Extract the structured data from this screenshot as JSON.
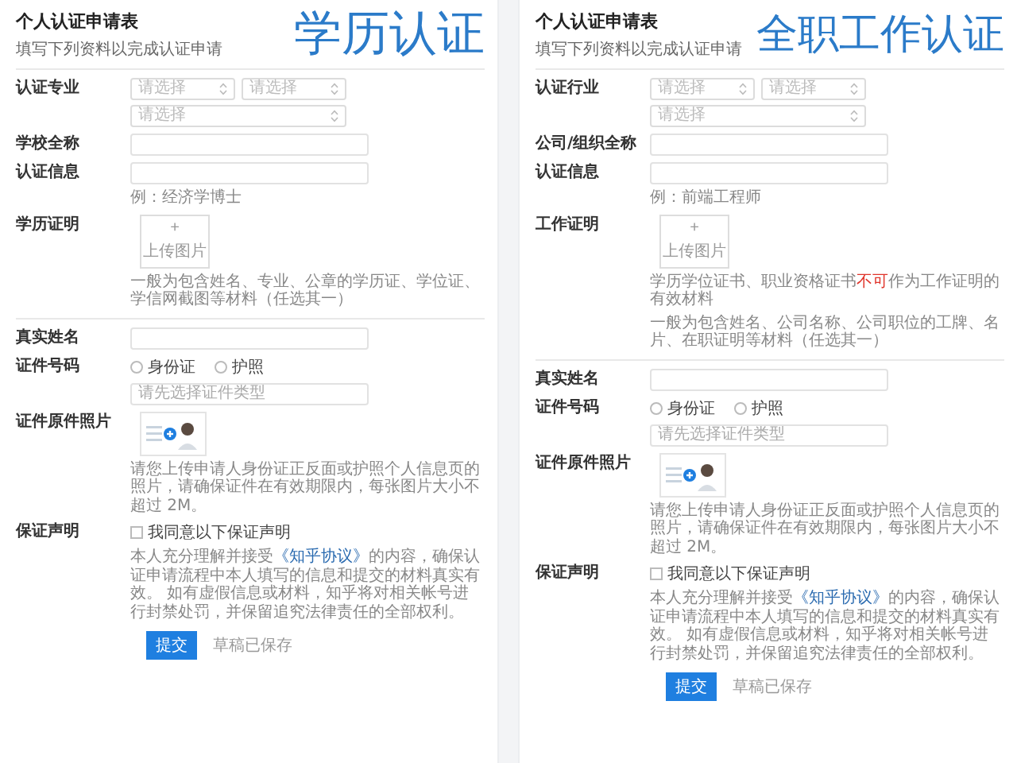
{
  "panels": [
    {
      "title": "个人认证申请表",
      "subtitle": "填写下列资料以完成认证申请",
      "banner": "学历认证",
      "sections": [
        {
          "rows": [
            {
              "kind": "selects",
              "label": "认证专业",
              "select_rows": [
                [
                  {
                    "placeholder": "请选择"
                  },
                  {
                    "placeholder": "请选择"
                  }
                ],
                [
                  {
                    "placeholder": "请选择"
                  }
                ]
              ]
            },
            {
              "kind": "input",
              "label": "学校全称"
            },
            {
              "kind": "input",
              "label": "认证信息",
              "hint": [
                [
                  {
                    "text": "例：经济学博士",
                    "kind": "text"
                  }
                ]
              ]
            },
            {
              "kind": "upload",
              "label": "学历证明",
              "upload": {
                "sign": "+",
                "text": "上传图片"
              },
              "hint": [
                [
                  {
                    "text": "一般为包含姓名、专业、公章的学历证、学位证、学信网截图等材料（任选其一）",
                    "kind": "text"
                  }
                ]
              ]
            }
          ]
        },
        {
          "rows": [
            {
              "kind": "input",
              "label": "真实姓名"
            },
            {
              "kind": "radios",
              "label": "证件号码",
              "options": [
                {
                  "label": "身份证",
                  "selected": false
                },
                {
                  "label": "护照",
                  "selected": false
                }
              ],
              "input": {
                "placeholder": "请先选择证件类型"
              }
            },
            {
              "kind": "id_photo",
              "label": "证件原件照片",
              "hint": [
                [
                  {
                    "text": "请您上传申请人身份证正反面或护照个人信息页的照片，请确保证件在有效期限内，每张图片大小不超过 2M。",
                    "kind": "text"
                  }
                ]
              ]
            },
            {
              "kind": "agreement",
              "label": "保证声明",
              "checkbox": {
                "label": "我同意以下保证声明",
                "checked": false
              },
              "hint": [
                [
                  {
                    "text": "本人充分理解并接受",
                    "kind": "text"
                  },
                  {
                    "text": "《知乎协议》",
                    "kind": "link"
                  },
                  {
                    "text": "的内容，确保认证申请流程中本人填写的信息和提交的材料真实有效。 如有虚假信息或材料，知乎将对相关帐号进行封禁处罚，并保留追究法律责任的全部权利。",
                    "kind": "text"
                  }
                ]
              ]
            }
          ]
        }
      ],
      "actions": {
        "submit": "提交",
        "draft": "草稿已保存"
      }
    },
    {
      "title": "个人认证申请表",
      "subtitle": "填写下列资料以完成认证申请",
      "banner": "全职工作认证",
      "sections": [
        {
          "rows": [
            {
              "kind": "selects",
              "label": "认证行业",
              "select_rows": [
                [
                  {
                    "placeholder": "请选择"
                  },
                  {
                    "placeholder": "请选择"
                  }
                ],
                [
                  {
                    "placeholder": "请选择"
                  }
                ]
              ]
            },
            {
              "kind": "input",
              "label": "公司/组织全称"
            },
            {
              "kind": "input",
              "label": "认证信息",
              "hint": [
                [
                  {
                    "text": "例：前端工程师",
                    "kind": "text"
                  }
                ]
              ]
            },
            {
              "kind": "upload",
              "label": "工作证明",
              "upload": {
                "sign": "+",
                "text": "上传图片"
              },
              "hint": [
                [
                  {
                    "text": "学历学位证书、职业资格证书",
                    "kind": "text"
                  },
                  {
                    "text": "不可",
                    "kind": "alert"
                  },
                  {
                    "text": "作为工作证明的有效材料",
                    "kind": "text"
                  }
                ],
                [
                  {
                    "text": "一般为包含姓名、公司名称、公司职位的工牌、名片、在职证明等材料（任选其一）",
                    "kind": "text"
                  }
                ]
              ]
            }
          ]
        },
        {
          "rows": [
            {
              "kind": "input",
              "label": "真实姓名"
            },
            {
              "kind": "radios",
              "label": "证件号码",
              "options": [
                {
                  "label": "身份证",
                  "selected": false
                },
                {
                  "label": "护照",
                  "selected": false
                }
              ],
              "input": {
                "placeholder": "请先选择证件类型"
              }
            },
            {
              "kind": "id_photo",
              "label": "证件原件照片",
              "hint": [
                [
                  {
                    "text": "请您上传申请人身份证正反面或护照个人信息页的照片，请确保证件在有效期限内，每张图片大小不超过 2M。",
                    "kind": "text"
                  }
                ]
              ]
            },
            {
              "kind": "agreement",
              "label": "保证声明",
              "checkbox": {
                "label": "我同意以下保证声明",
                "checked": false
              },
              "hint": [
                [
                  {
                    "text": "本人充分理解并接受",
                    "kind": "text"
                  },
                  {
                    "text": "《知乎协议》",
                    "kind": "link"
                  },
                  {
                    "text": "的内容，确保认证申请流程中本人填写的信息和提交的材料真实有效。 如有虚假信息或材料，知乎将对相关帐号进行封禁处罚，并保留追究法律责任的全部权利。",
                    "kind": "text"
                  }
                ]
              ]
            }
          ]
        }
      ],
      "actions": {
        "submit": "提交",
        "draft": "草稿已保存"
      }
    }
  ]
}
